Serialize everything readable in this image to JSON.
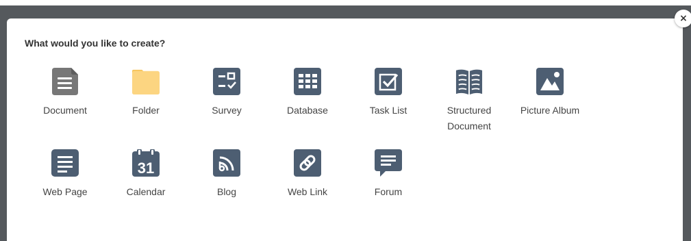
{
  "dialog": {
    "heading": "What would you like to create?",
    "close_label": "×"
  },
  "colors": {
    "icon_slate": "#4d5e72",
    "icon_gray": "#777777",
    "folder_yellow": "#fcd581",
    "folder_tab": "#f6c45b"
  },
  "items": [
    {
      "label": "Document",
      "icon": "document-icon"
    },
    {
      "label": "Folder",
      "icon": "folder-icon"
    },
    {
      "label": "Survey",
      "icon": "survey-icon"
    },
    {
      "label": "Database",
      "icon": "database-icon"
    },
    {
      "label": "Task List",
      "icon": "task-list-icon"
    },
    {
      "label": "Structured Document",
      "icon": "structured-document-icon"
    },
    {
      "label": "Picture Album",
      "icon": "picture-album-icon"
    },
    {
      "label": "Web Page",
      "icon": "web-page-icon"
    },
    {
      "label": "Calendar",
      "icon": "calendar-icon",
      "icon_text": "31"
    },
    {
      "label": "Blog",
      "icon": "blog-icon"
    },
    {
      "label": "Web Link",
      "icon": "web-link-icon"
    },
    {
      "label": "Forum",
      "icon": "forum-icon"
    }
  ]
}
